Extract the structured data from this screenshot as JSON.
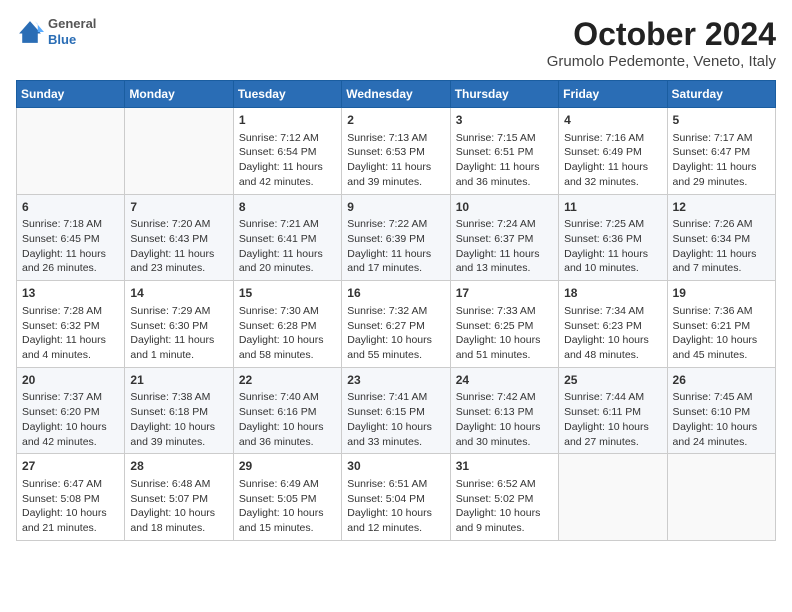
{
  "header": {
    "logo": {
      "general": "General",
      "blue": "Blue"
    },
    "month": "October 2024",
    "location": "Grumolo Pedemonte, Veneto, Italy"
  },
  "days_of_week": [
    "Sunday",
    "Monday",
    "Tuesday",
    "Wednesday",
    "Thursday",
    "Friday",
    "Saturday"
  ],
  "weeks": [
    [
      {
        "day": "",
        "info": ""
      },
      {
        "day": "",
        "info": ""
      },
      {
        "day": "1",
        "info": "Sunrise: 7:12 AM\nSunset: 6:54 PM\nDaylight: 11 hours and 42 minutes."
      },
      {
        "day": "2",
        "info": "Sunrise: 7:13 AM\nSunset: 6:53 PM\nDaylight: 11 hours and 39 minutes."
      },
      {
        "day": "3",
        "info": "Sunrise: 7:15 AM\nSunset: 6:51 PM\nDaylight: 11 hours and 36 minutes."
      },
      {
        "day": "4",
        "info": "Sunrise: 7:16 AM\nSunset: 6:49 PM\nDaylight: 11 hours and 32 minutes."
      },
      {
        "day": "5",
        "info": "Sunrise: 7:17 AM\nSunset: 6:47 PM\nDaylight: 11 hours and 29 minutes."
      }
    ],
    [
      {
        "day": "6",
        "info": "Sunrise: 7:18 AM\nSunset: 6:45 PM\nDaylight: 11 hours and 26 minutes."
      },
      {
        "day": "7",
        "info": "Sunrise: 7:20 AM\nSunset: 6:43 PM\nDaylight: 11 hours and 23 minutes."
      },
      {
        "day": "8",
        "info": "Sunrise: 7:21 AM\nSunset: 6:41 PM\nDaylight: 11 hours and 20 minutes."
      },
      {
        "day": "9",
        "info": "Sunrise: 7:22 AM\nSunset: 6:39 PM\nDaylight: 11 hours and 17 minutes."
      },
      {
        "day": "10",
        "info": "Sunrise: 7:24 AM\nSunset: 6:37 PM\nDaylight: 11 hours and 13 minutes."
      },
      {
        "day": "11",
        "info": "Sunrise: 7:25 AM\nSunset: 6:36 PM\nDaylight: 11 hours and 10 minutes."
      },
      {
        "day": "12",
        "info": "Sunrise: 7:26 AM\nSunset: 6:34 PM\nDaylight: 11 hours and 7 minutes."
      }
    ],
    [
      {
        "day": "13",
        "info": "Sunrise: 7:28 AM\nSunset: 6:32 PM\nDaylight: 11 hours and 4 minutes."
      },
      {
        "day": "14",
        "info": "Sunrise: 7:29 AM\nSunset: 6:30 PM\nDaylight: 11 hours and 1 minute."
      },
      {
        "day": "15",
        "info": "Sunrise: 7:30 AM\nSunset: 6:28 PM\nDaylight: 10 hours and 58 minutes."
      },
      {
        "day": "16",
        "info": "Sunrise: 7:32 AM\nSunset: 6:27 PM\nDaylight: 10 hours and 55 minutes."
      },
      {
        "day": "17",
        "info": "Sunrise: 7:33 AM\nSunset: 6:25 PM\nDaylight: 10 hours and 51 minutes."
      },
      {
        "day": "18",
        "info": "Sunrise: 7:34 AM\nSunset: 6:23 PM\nDaylight: 10 hours and 48 minutes."
      },
      {
        "day": "19",
        "info": "Sunrise: 7:36 AM\nSunset: 6:21 PM\nDaylight: 10 hours and 45 minutes."
      }
    ],
    [
      {
        "day": "20",
        "info": "Sunrise: 7:37 AM\nSunset: 6:20 PM\nDaylight: 10 hours and 42 minutes."
      },
      {
        "day": "21",
        "info": "Sunrise: 7:38 AM\nSunset: 6:18 PM\nDaylight: 10 hours and 39 minutes."
      },
      {
        "day": "22",
        "info": "Sunrise: 7:40 AM\nSunset: 6:16 PM\nDaylight: 10 hours and 36 minutes."
      },
      {
        "day": "23",
        "info": "Sunrise: 7:41 AM\nSunset: 6:15 PM\nDaylight: 10 hours and 33 minutes."
      },
      {
        "day": "24",
        "info": "Sunrise: 7:42 AM\nSunset: 6:13 PM\nDaylight: 10 hours and 30 minutes."
      },
      {
        "day": "25",
        "info": "Sunrise: 7:44 AM\nSunset: 6:11 PM\nDaylight: 10 hours and 27 minutes."
      },
      {
        "day": "26",
        "info": "Sunrise: 7:45 AM\nSunset: 6:10 PM\nDaylight: 10 hours and 24 minutes."
      }
    ],
    [
      {
        "day": "27",
        "info": "Sunrise: 6:47 AM\nSunset: 5:08 PM\nDaylight: 10 hours and 21 minutes."
      },
      {
        "day": "28",
        "info": "Sunrise: 6:48 AM\nSunset: 5:07 PM\nDaylight: 10 hours and 18 minutes."
      },
      {
        "day": "29",
        "info": "Sunrise: 6:49 AM\nSunset: 5:05 PM\nDaylight: 10 hours and 15 minutes."
      },
      {
        "day": "30",
        "info": "Sunrise: 6:51 AM\nSunset: 5:04 PM\nDaylight: 10 hours and 12 minutes."
      },
      {
        "day": "31",
        "info": "Sunrise: 6:52 AM\nSunset: 5:02 PM\nDaylight: 10 hours and 9 minutes."
      },
      {
        "day": "",
        "info": ""
      },
      {
        "day": "",
        "info": ""
      }
    ]
  ]
}
